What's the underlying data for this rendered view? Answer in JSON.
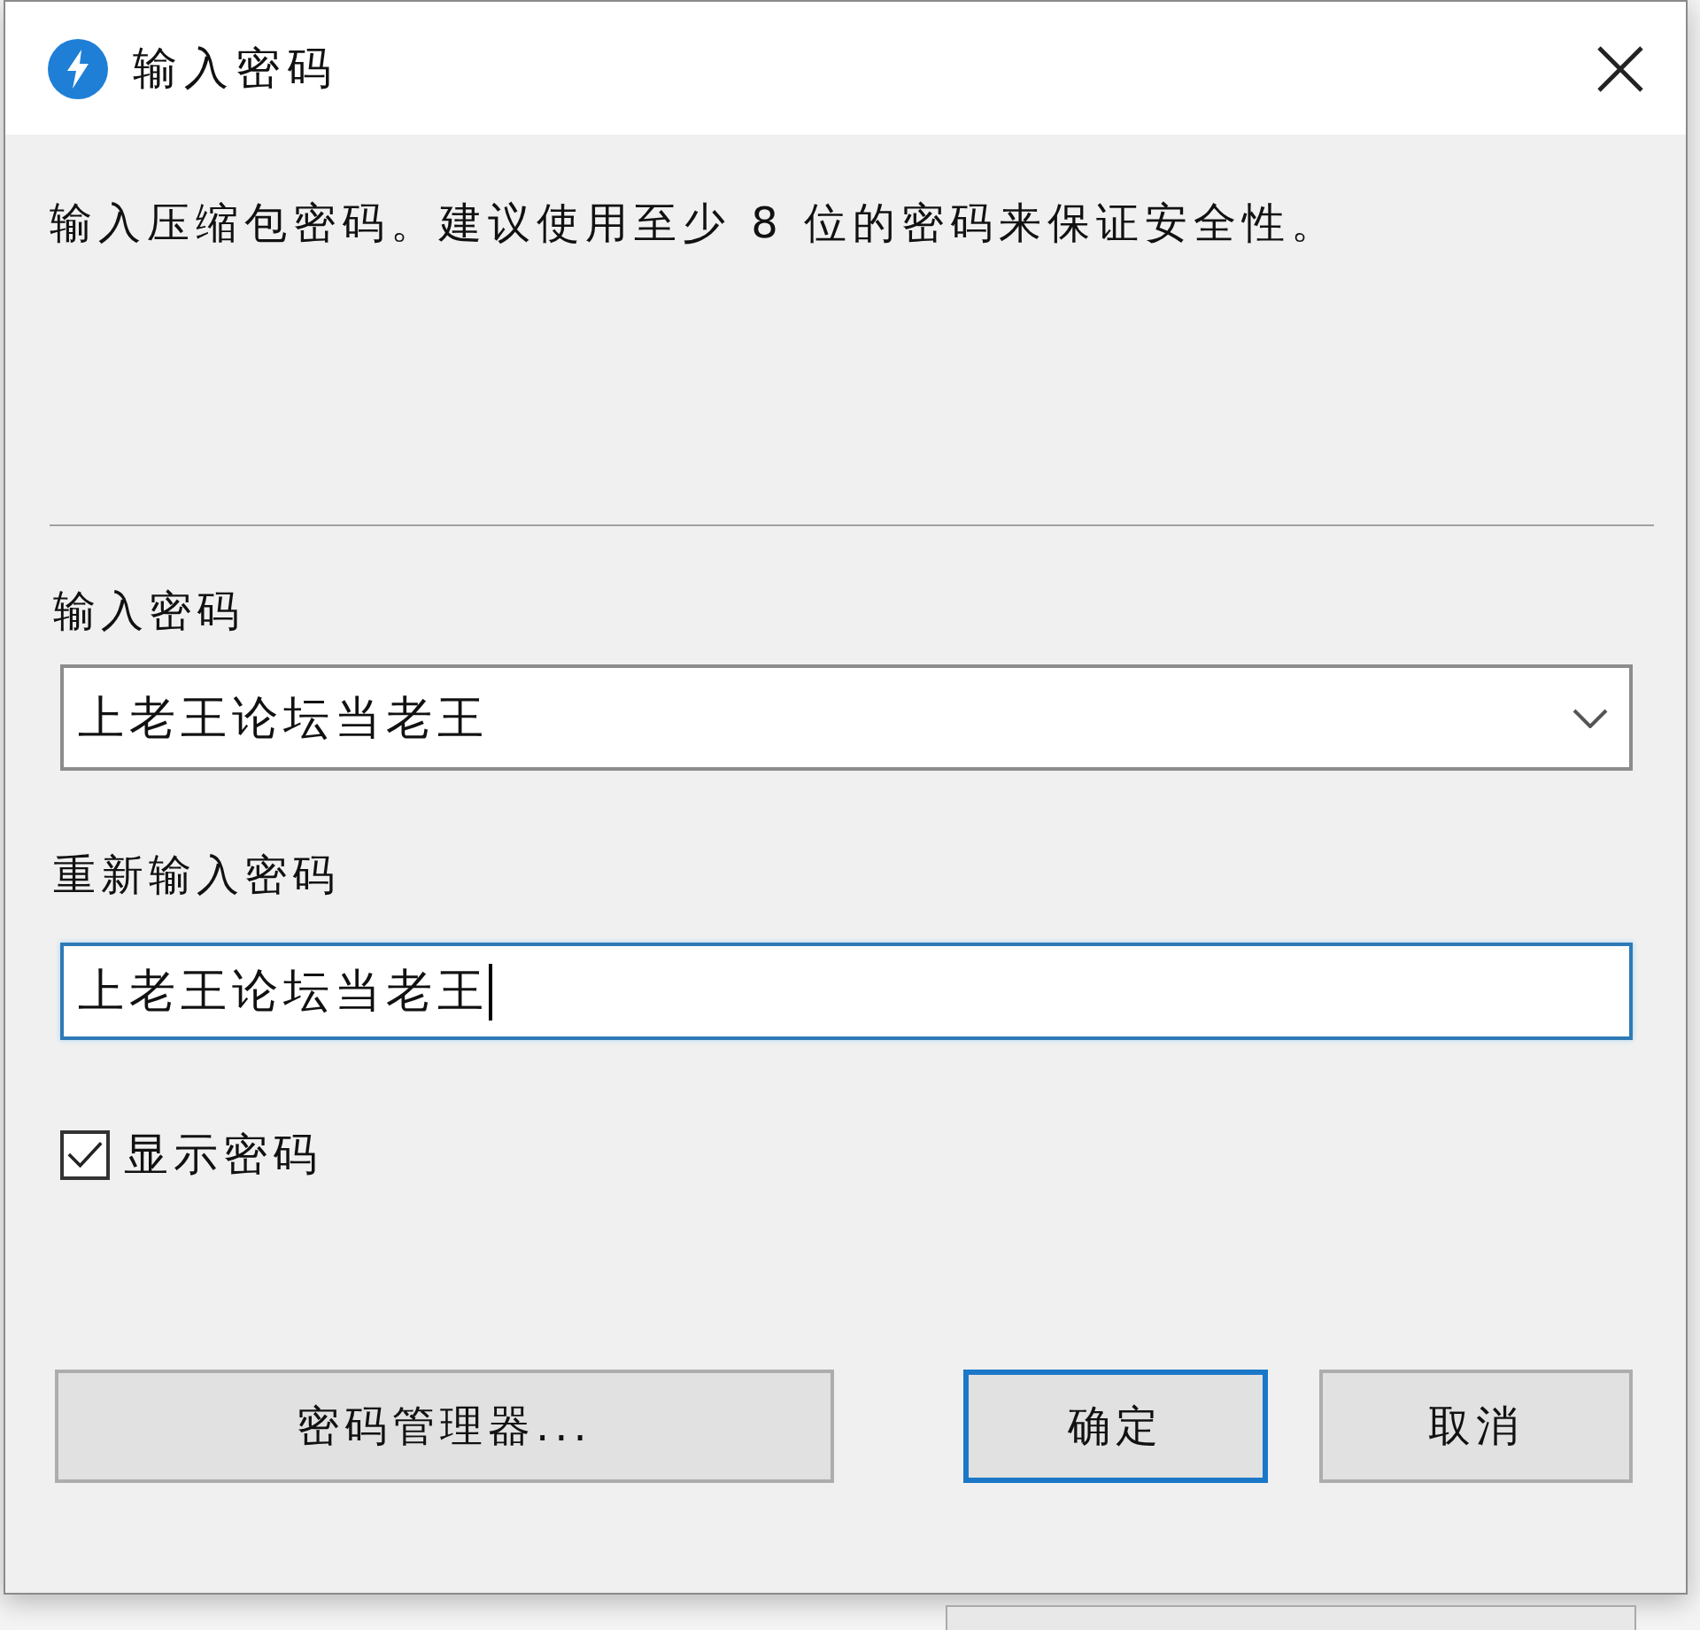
{
  "window": {
    "title": "输入密码"
  },
  "description": "输入压缩包密码。建议使用至少 8 位的密码来保证安全性。",
  "fields": [
    {
      "kind": "combo",
      "label": "输入密码",
      "value": "上老王论坛当老王",
      "focused": false
    },
    {
      "kind": "text",
      "label": "重新输入密码",
      "value": "上老王论坛当老王",
      "focused": true
    }
  ],
  "show_password": {
    "label": "显示密码",
    "checked": true
  },
  "buttons": [
    {
      "label": "密码管理器...",
      "default": false
    },
    {
      "label": "确定",
      "default": true
    },
    {
      "label": "取消",
      "default": false
    }
  ]
}
